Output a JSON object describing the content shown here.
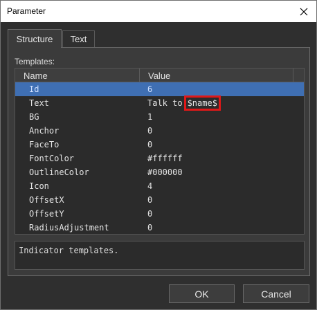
{
  "window": {
    "title": "Parameter"
  },
  "tabs": [
    {
      "label": "Structure",
      "active": true
    },
    {
      "label": "Text",
      "active": false
    }
  ],
  "templates_label": "Templates:",
  "grid": {
    "columns": [
      "Name",
      "Value"
    ],
    "rows": [
      {
        "name": "Id",
        "value": "6"
      },
      {
        "name": "Text",
        "value": "Talk to",
        "highlight": "$name$"
      },
      {
        "name": "BG",
        "value": "1"
      },
      {
        "name": "Anchor",
        "value": "0"
      },
      {
        "name": "FaceTo",
        "value": "0"
      },
      {
        "name": "FontColor",
        "value": "#ffffff"
      },
      {
        "name": "OutlineColor",
        "value": "#000000"
      },
      {
        "name": "Icon",
        "value": "4"
      },
      {
        "name": "OffsetX",
        "value": "0"
      },
      {
        "name": "OffsetY",
        "value": "0"
      },
      {
        "name": "RadiusAdjustment",
        "value": "0"
      }
    ],
    "selected_row": 0
  },
  "description": "Indicator templates.",
  "buttons": {
    "ok": "OK",
    "cancel": "Cancel"
  },
  "colors": {
    "selection": "#3f6fb3",
    "highlight_box": "#e01818",
    "background": "#2f2f2f"
  }
}
